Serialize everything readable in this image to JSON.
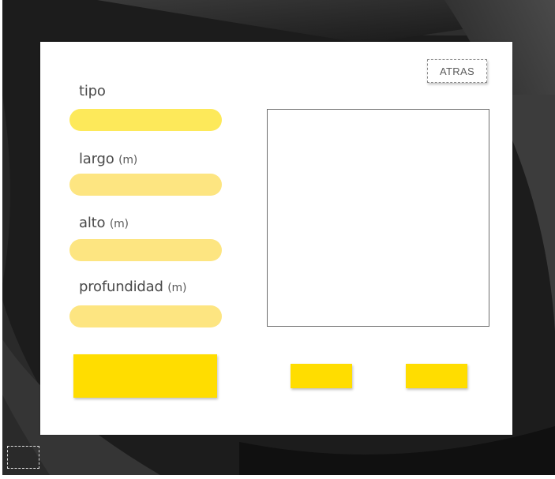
{
  "panel": {
    "back_label": "ATRAS",
    "fields": [
      {
        "label": "tipo",
        "unit": "",
        "value": ""
      },
      {
        "label": "largo",
        "unit": "(m)",
        "value": ""
      },
      {
        "label": "alto",
        "unit": "(m)",
        "value": ""
      },
      {
        "label": "profundidad",
        "unit": "(m)",
        "value": ""
      }
    ]
  },
  "colors": {
    "accent_yellow": "#ffdd00",
    "input_primary": "#fde95a",
    "input_soft": "#fde581",
    "background_dark": "#1e1e1e"
  }
}
